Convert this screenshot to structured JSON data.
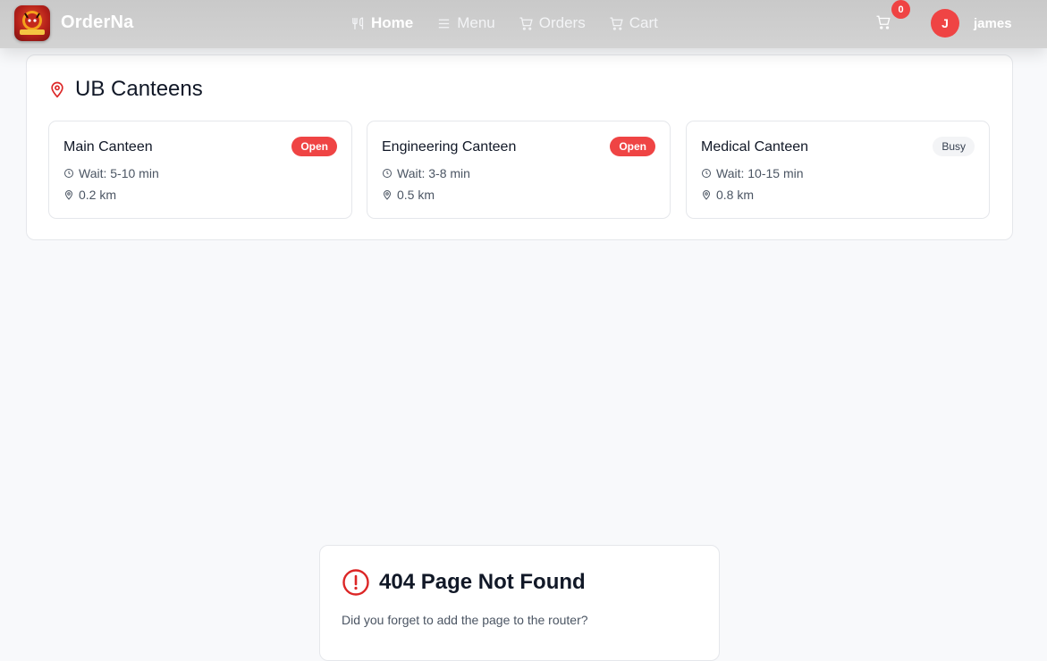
{
  "app": {
    "brand": "OrderNa",
    "logo_text": "ORDERNA"
  },
  "nav": {
    "links": [
      {
        "label": "Home",
        "icon": "utensils-icon",
        "active": true
      },
      {
        "label": "Menu",
        "icon": "menu-lines-icon",
        "active": false
      },
      {
        "label": "Orders",
        "icon": "cart-icon",
        "active": false
      },
      {
        "label": "Cart",
        "icon": "cart-icon",
        "active": false
      }
    ],
    "cart_count": "0",
    "user": {
      "initial": "J",
      "name": "james"
    }
  },
  "canteens": {
    "title": "UB Canteens",
    "items": [
      {
        "name": "Main Canteen",
        "status": "Open",
        "wait": "Wait: 5-10 min",
        "distance": "0.2 km"
      },
      {
        "name": "Engineering Canteen",
        "status": "Open",
        "wait": "Wait: 3-8 min",
        "distance": "0.5 km"
      },
      {
        "name": "Medical Canteen",
        "status": "Busy",
        "wait": "Wait: 10-15 min",
        "distance": "0.8 km"
      }
    ]
  },
  "error": {
    "title": "404 Page Not Found",
    "message": "Did you forget to add the page to the router?"
  },
  "colors": {
    "accent": "#ef4444",
    "pin": "#dc2626",
    "navbar": "#cccccc"
  }
}
